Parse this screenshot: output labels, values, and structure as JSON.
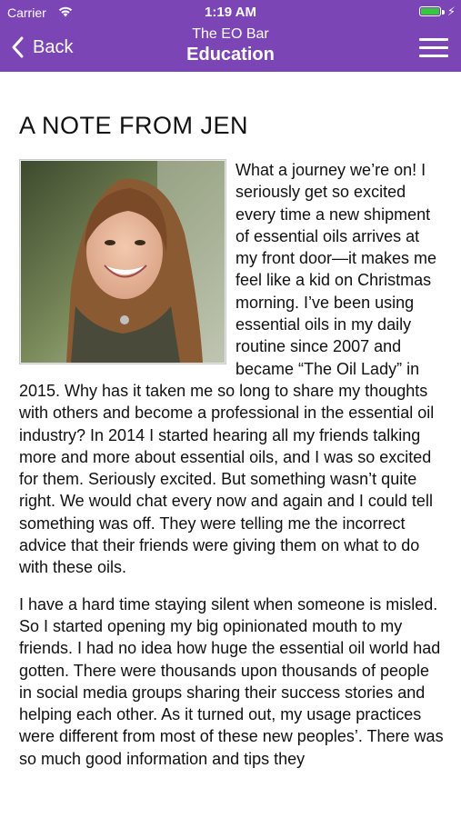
{
  "status": {
    "carrier": "Carrier",
    "time": "1:19 AM"
  },
  "nav": {
    "back_label": "Back",
    "subtitle": "The EO Bar",
    "title": "Education"
  },
  "article": {
    "heading": "A NOTE FROM JEN",
    "paragraphs": [
      "What a journey we’re on! I seriously get so excited every time a new shipment of essential oils arrives at my front door—it makes me feel like a kid on Christmas morning. I’ve been using essential oils in my daily routine since 2007 and became “The Oil Lady” in 2015. Why has it taken me so long to share my thoughts with others and become a professional in the essential oil industry? In 2014 I started hearing all my friends talking more and more about essential oils, and I was so excited for them. Seriously excited. But something wasn’t quite right. We would chat every now and again and I could tell something was off. They were telling me the incorrect advice that their friends were giving them on what to do with these oils.",
      "I have a hard time staying silent when someone is misled. So I started opening my big opinionated mouth to my friends. I had no idea how huge the essential oil world had gotten. There were thousands upon thousands of people in social media groups sharing their success stories and helping each other. As it turned out, my usage practices were different from most of these new peoples’. There was so much good information and tips they"
    ]
  },
  "colors": {
    "nav_bg": "#7b45b5",
    "battery": "#37c640"
  },
  "icons": {
    "wifi": "wifi-icon",
    "battery": "battery-icon",
    "back": "chevron-left-icon",
    "menu": "hamburger-menu-icon"
  }
}
